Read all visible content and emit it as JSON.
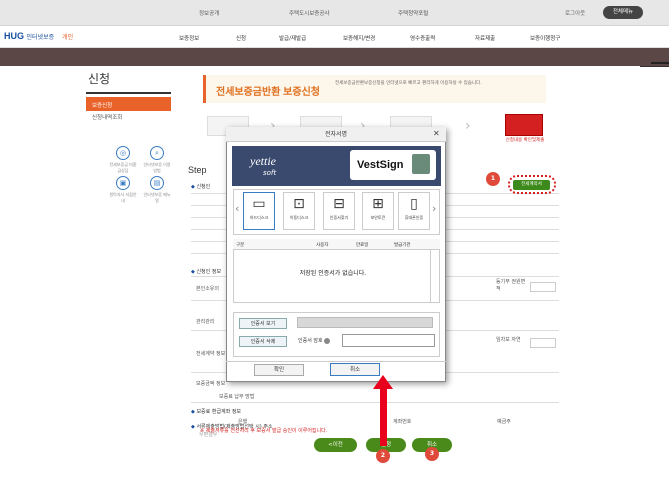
{
  "topbar": {
    "links": [
      "정보공개",
      "주택도시보증공사",
      "주택청약포털"
    ],
    "login": "로그아웃",
    "btn": "전체메뉴"
  },
  "nav": {
    "logo": "HUG",
    "logo_sub": "인터넷보증",
    "logo_mark": "개인",
    "items": [
      "보증정보",
      "신청",
      "발급/재발급",
      "보증해지/변경",
      "영수증출력",
      "자료제출",
      "보증이행청구"
    ]
  },
  "side": {
    "title": "신청",
    "selected": "보증신청",
    "item2": "신청내역조회",
    "quick": [
      "전세보증금 미환급상담",
      "인터넷보증 이용방법",
      "원탁지사 지점안내",
      "인터넷보증 매뉴얼"
    ]
  },
  "header": {
    "title": "전세보증금반환 보증신청",
    "sub": "전세보증금반환보증신청을 인터넷으로 빠르고 편리하게 이용하실 수 있습니다."
  },
  "steps": {
    "red_label": "신청내용 확인및제출",
    "step_title": "Step"
  },
  "form": {
    "green_btn": "전세계약서",
    "badges": [
      "1",
      "2",
      "3"
    ],
    "notice": "※ 제출서류를 전산처리 후 보증서 발급 승인이 이루어집니다.",
    "buttons": [
      "<이전",
      "신청",
      "취소"
    ],
    "sections": [
      "신청인",
      "신청인 정보",
      "보증료 환급계좌 정보",
      "서류제출방법(제출방법선택 시) 주소"
    ],
    "labels": [
      "본인소유의",
      "관리관리",
      "전세계약 정보",
      "보증금액 정보",
      "보증료 납부 방법",
      "은행",
      "계좌번호",
      "예금주",
      "우편결우",
      "등기부 권원면적",
      "임차보 자연"
    ]
  },
  "dialog": {
    "title": "전자서명",
    "brand1": "yettie",
    "brand2": "soft",
    "vest": "VestSign",
    "media": [
      "하드디스크",
      "이동디스크",
      "인증서찾기",
      "보안토큰",
      "휴대폰인증"
    ],
    "cols": [
      "구분",
      "사용자",
      "만료일",
      "발급기관"
    ],
    "empty": "저장된 인증서가 없습니다.",
    "view": "인증서 보기",
    "delete": "인증서 삭제",
    "pw_label": "인증서 암호",
    "ok": "확인",
    "cancel": "취소"
  }
}
